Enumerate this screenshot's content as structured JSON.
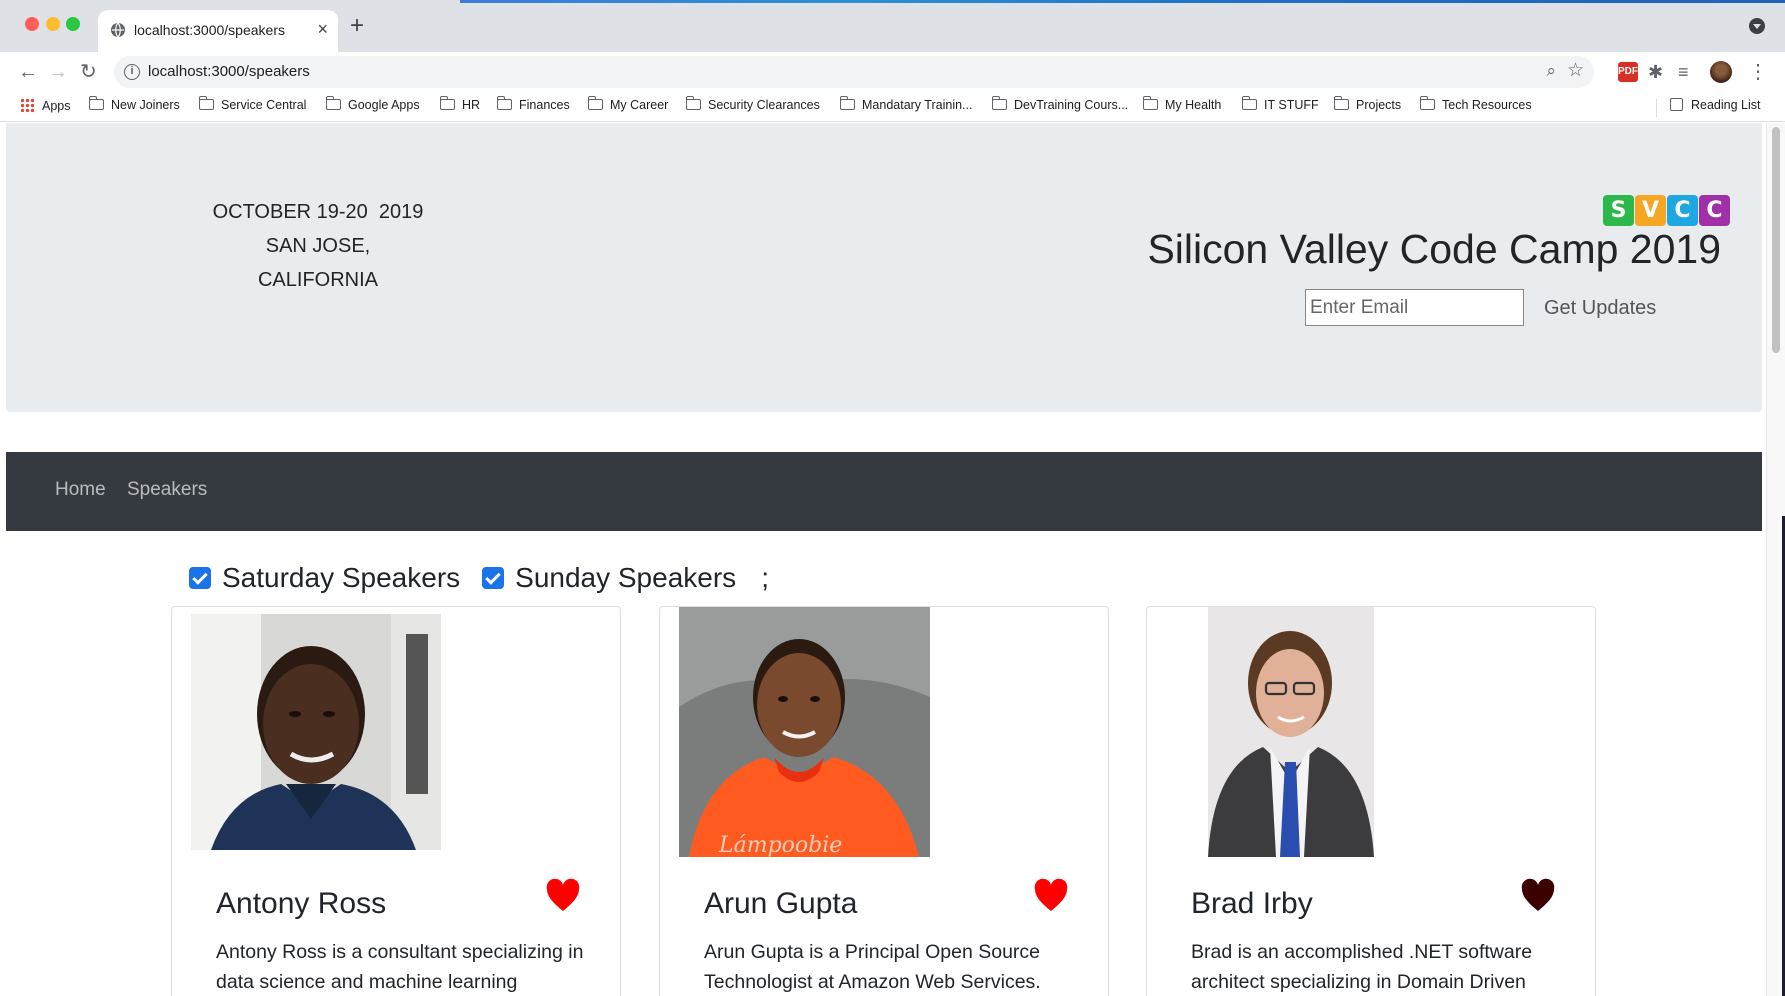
{
  "browser": {
    "tab_title": "localhost:3000/speakers",
    "url": "localhost:3000/speakers",
    "bookmarks": [
      "Apps",
      "New Joiners",
      "Service Central",
      "Google Apps",
      "HR",
      "Finances",
      "My Career",
      "Security Clearances",
      "Mandatary Trainin...",
      "DevTraining Cours...",
      "My Health",
      "IT STUFF",
      "Projects",
      "Tech Resources"
    ],
    "reading_list": "Reading List",
    "extension_pdf": "PDF"
  },
  "header": {
    "date_line": "OCTOBER 19-20  2019",
    "location_line": "SAN JOSE, CALIFORNIA",
    "logo_letters": [
      "S",
      "V",
      "C",
      "C"
    ],
    "logo_colors": [
      "#2db84b",
      "#f5a623",
      "#1ea7e1",
      "#a12fa8"
    ],
    "site_title": "Silicon Valley Code Camp 2019",
    "email_placeholder": "Enter Email",
    "updates_label": "Get Updates"
  },
  "nav": {
    "home": "Home",
    "speakers": "Speakers"
  },
  "filters": {
    "saturday_label": "Saturday Speakers",
    "saturday_checked": true,
    "sunday_label": "Sunday Speakers",
    "sunday_checked": true,
    "trailing": ";"
  },
  "speakers": [
    {
      "name": "Antony Ross",
      "bio": "Antony Ross is a consultant specializing in data science and machine learning",
      "favorite": true,
      "heart_color": "#ff0000"
    },
    {
      "name": "Arun Gupta",
      "bio": "Arun Gupta is a Principal Open Source Technologist at Amazon Web Services.",
      "favorite": true,
      "heart_color": "#ff0000"
    },
    {
      "name": "Brad Irby",
      "bio": "Brad is an accomplished .NET software architect specializing in Domain Driven",
      "favorite": false,
      "heart_color": "#3d0000"
    }
  ]
}
